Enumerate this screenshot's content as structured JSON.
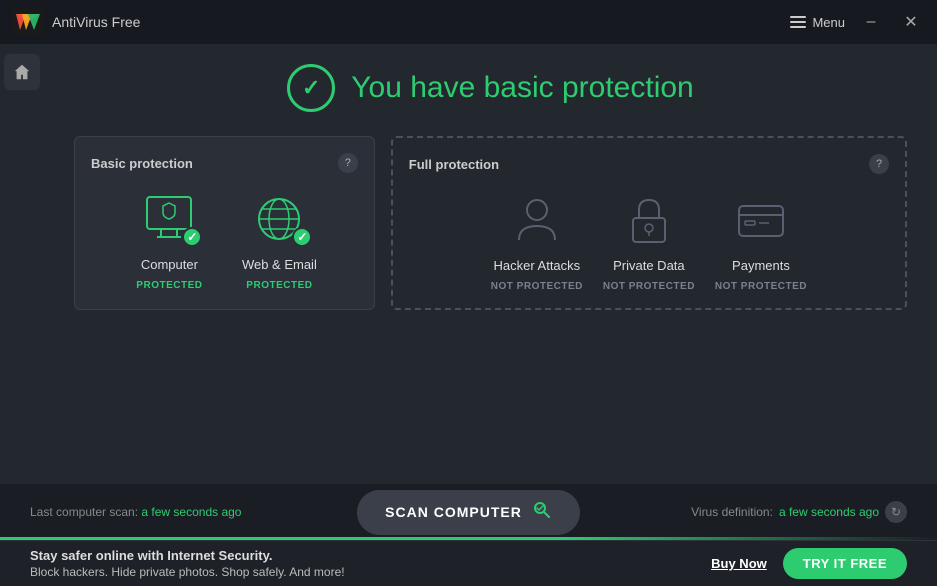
{
  "titleBar": {
    "appName": "AntiVirus Free",
    "brandName": "AVG",
    "menuLabel": "Menu",
    "minimizeLabel": "–",
    "closeLabel": "✕"
  },
  "statusHeader": {
    "text": "You have basic protection"
  },
  "basicPanel": {
    "title": "Basic protection",
    "helpLabel": "?",
    "items": [
      {
        "label": "Computer",
        "status": "PROTECTED",
        "protected": true,
        "iconType": "computer"
      },
      {
        "label": "Web & Email",
        "status": "PROTECTED",
        "protected": true,
        "iconType": "web"
      }
    ]
  },
  "fullPanel": {
    "title": "Full protection",
    "helpLabel": "?",
    "items": [
      {
        "label": "Hacker Attacks",
        "status": "NOT PROTECTED",
        "protected": false,
        "iconType": "hacker"
      },
      {
        "label": "Private Data",
        "status": "NOT PROTECTED",
        "protected": false,
        "iconType": "lock"
      },
      {
        "label": "Payments",
        "status": "NOT PROTECTED",
        "protected": false,
        "iconType": "card"
      }
    ]
  },
  "bottomBar": {
    "scanInfo": "Last computer scan:",
    "scanTime": "a few seconds ago",
    "scanButtonLabel": "SCAN COMPUTER",
    "virusInfo": "Virus definition:",
    "virusTime": "a few seconds ago"
  },
  "promoBar": {
    "title": "Stay safer online with Internet Security.",
    "subtitle": "Block hackers. Hide private photos. Shop safely. And more!",
    "buyLabel": "Buy Now",
    "tryLabel": "TRY IT FREE"
  }
}
